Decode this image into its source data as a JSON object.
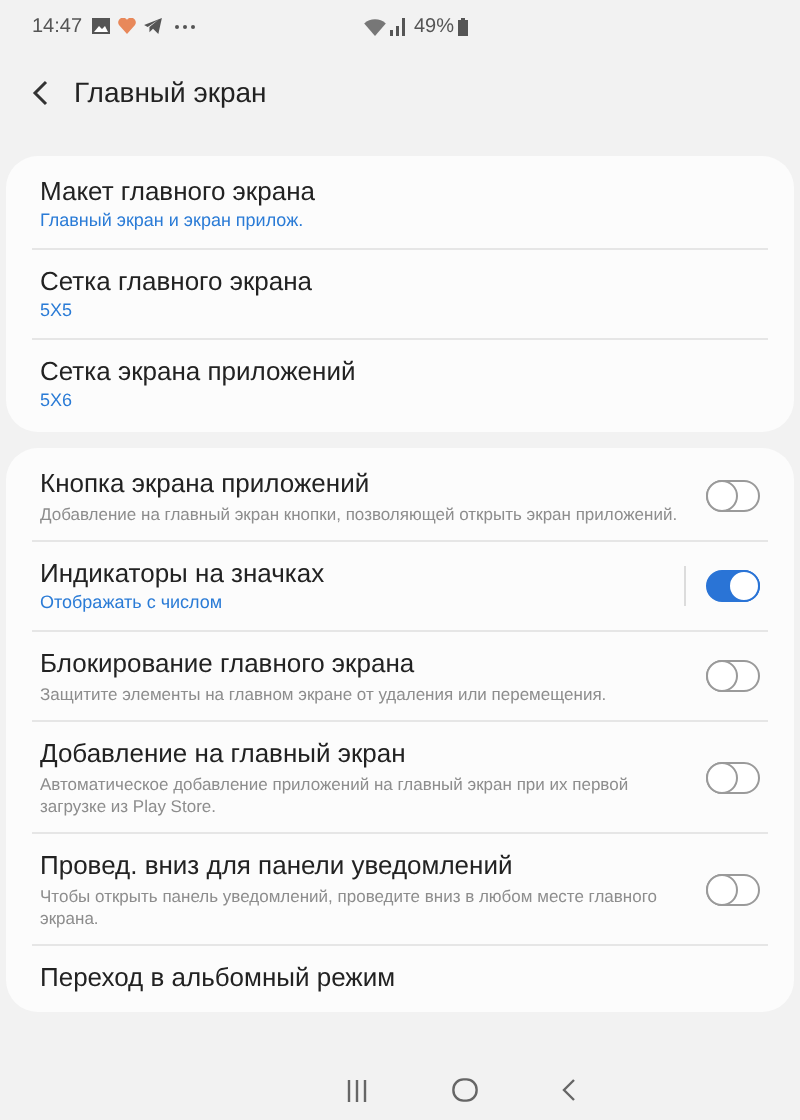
{
  "status_bar": {
    "time": "14:47",
    "battery": "49%"
  },
  "header": {
    "title": "Главный экран"
  },
  "sections": [
    {
      "items": [
        {
          "kind": "link",
          "title": "Макет главного экрана",
          "value": "Главный экран и экран прилож."
        },
        {
          "kind": "link",
          "title": "Сетка главного экрана",
          "value": "5X5"
        },
        {
          "kind": "link",
          "title": "Сетка экрана приложений",
          "value": "5X6"
        }
      ]
    },
    {
      "items": [
        {
          "kind": "toggle",
          "title": "Кнопка экрана приложений",
          "description": "Добавление на главный экран кнопки, позволяющей открыть экран приложений.",
          "on": false
        },
        {
          "kind": "split_toggle",
          "title": "Индикаторы на значках",
          "value": "Отображать с числом",
          "on": true
        },
        {
          "kind": "toggle",
          "title": "Блокирование главного экрана",
          "description": "Защитите элементы на главном экране от удаления или перемещения.",
          "on": false
        },
        {
          "kind": "toggle",
          "title": "Добавление на главный экран",
          "description": "Автоматическое добавление приложений на главный экран при их первой загрузке из Play Store.",
          "on": false
        },
        {
          "kind": "toggle",
          "title": "Провед. вниз для панели уведомлений",
          "description": "Чтобы открыть панель уведомлений, проведите вниз в любом месте главного экрана.",
          "on": false
        },
        {
          "kind": "link",
          "title": "Переход в альбомный режим"
        }
      ]
    }
  ]
}
